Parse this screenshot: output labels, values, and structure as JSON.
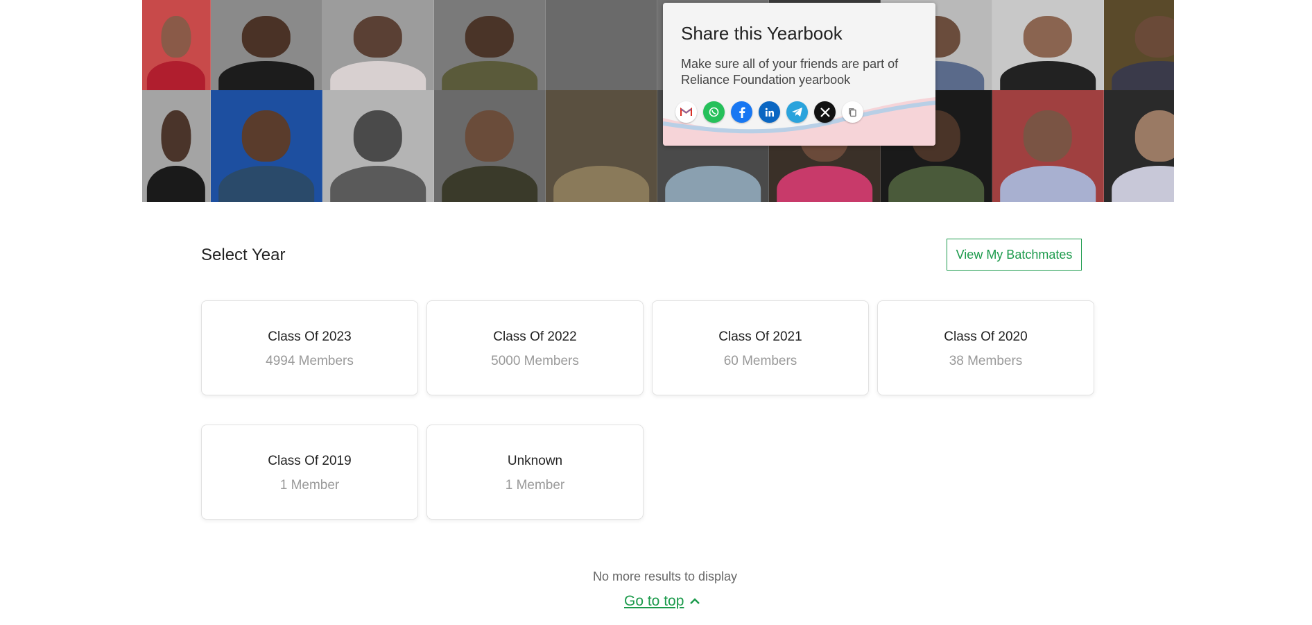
{
  "share": {
    "title": "Share this Yearbook",
    "description": "Make sure all of your friends are part of Reliance Foundation yearbook",
    "icons": [
      "gmail-icon",
      "whatsapp-icon",
      "facebook-icon",
      "linkedin-icon",
      "telegram-icon",
      "x-icon",
      "copy-icon"
    ]
  },
  "section": {
    "title": "Select Year",
    "batchmates_label": "View My Batchmates"
  },
  "years": [
    {
      "title": "Class Of 2023",
      "count": "4994 Members"
    },
    {
      "title": "Class Of 2022",
      "count": "5000 Members"
    },
    {
      "title": "Class Of 2021",
      "count": "60 Members"
    },
    {
      "title": "Class Of 2020",
      "count": "38 Members"
    },
    {
      "title": "Class Of 2019",
      "count": "1 Member"
    },
    {
      "title": "Unknown",
      "count": "1 Member"
    }
  ],
  "footer": {
    "end_message": "No more results to display",
    "go_top_label": "Go to top"
  },
  "colors": {
    "accent": "#1b9a4b",
    "gmail": "#ffffff",
    "whatsapp": "#25c05a",
    "facebook": "#1877f2",
    "linkedin": "#0a66c2",
    "telegram": "#2aa3dc",
    "x": "#111111",
    "copy": "#ffffff"
  }
}
